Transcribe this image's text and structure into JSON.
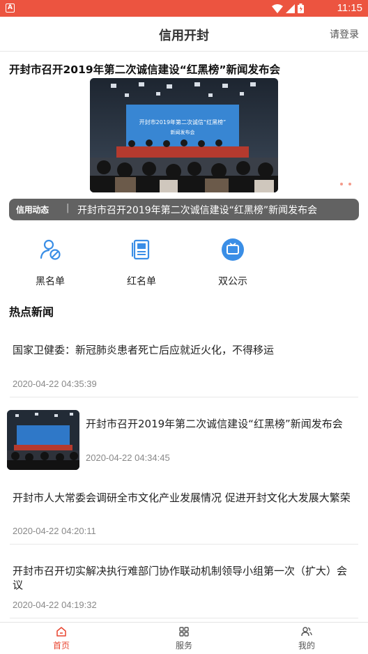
{
  "status_bar": {
    "time": "11:15"
  },
  "header": {
    "title": "信用开封",
    "login_label": "请登录"
  },
  "banner": {
    "title": "开封市召开2019年第二次诚信建设“红黑榜”新闻发布会",
    "image_caption_line1": "开封市2019年第二次诚信“红黑榜”",
    "image_caption_line2": "新闻发布会"
  },
  "ticker": {
    "tag": "信用动态",
    "separator": "|",
    "text": "开封市召开2019年第二次诚信建设“红黑榜”新闻发布会"
  },
  "quick_menu": {
    "items": [
      {
        "label": "黑名单",
        "icon": "blacklist-person-icon"
      },
      {
        "label": "红名单",
        "icon": "redlist-book-icon"
      },
      {
        "label": "双公示",
        "icon": "tv-display-icon"
      }
    ]
  },
  "section": {
    "title": "热点新闻"
  },
  "news": [
    {
      "title": "国家卫健委：新冠肺炎患者死亡后应就近火化，不得移运",
      "date": "2020-04-22 04:35:39"
    },
    {
      "title": "开封市召开2019年第二次诚信建设“红黑榜”新闻发布会",
      "date": "2020-04-22 04:34:45"
    },
    {
      "title": "开封市人大常委会调研全市文化产业发展情况 促进开封文化大发展大繁荣",
      "date": "2020-04-22 04:20:11"
    },
    {
      "title": "开封市召开切实解决执行难部门协作联动机制领导小组第一次（扩大）会议",
      "date": "2020-04-22 04:19:32"
    }
  ],
  "tabbar": {
    "items": [
      {
        "label": "首页",
        "icon": "home-icon",
        "active": true
      },
      {
        "label": "服务",
        "icon": "grid-service-icon",
        "active": false
      },
      {
        "label": "我的",
        "icon": "user-profile-icon",
        "active": false
      }
    ]
  },
  "colors": {
    "accent": "#e8442f",
    "status_bar": "#ec5440",
    "icon_blue": "#3a8ee6"
  }
}
